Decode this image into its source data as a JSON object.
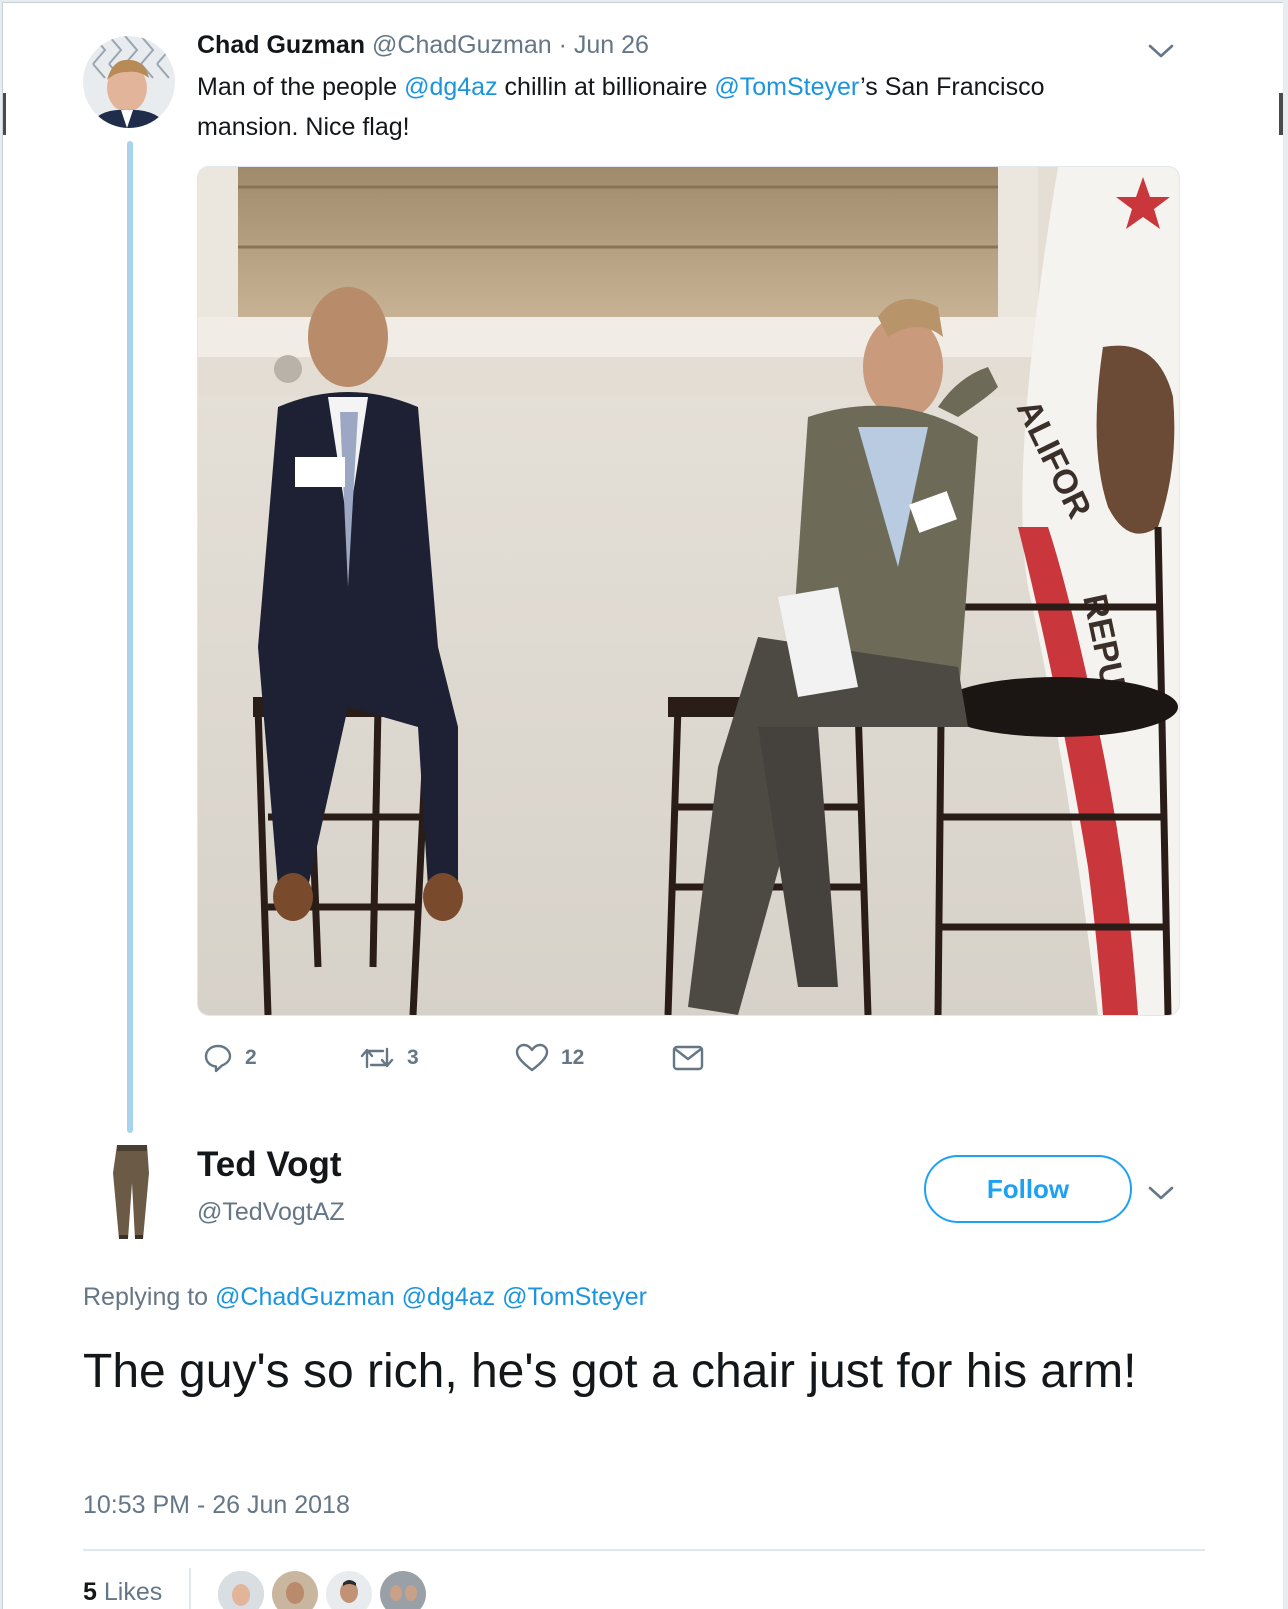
{
  "tweet": {
    "author_name": "Chad Guzman",
    "author_handle": "@ChadGuzman",
    "date": "· Jun 26",
    "text_1": "Man of the people ",
    "mention_1": "@dg4az",
    "text_2": " chillin at billionaire ",
    "mention_2": "@TomSteyer",
    "text_3": "’s San Francisco",
    "text_4": "mansion. Nice flag!",
    "photo_flag_text_1": "ALIFOR",
    "photo_flag_text_2": "REPU",
    "replies": "2",
    "retweets": "3",
    "likes": "12"
  },
  "reply": {
    "author_name": "Ted Vogt",
    "author_handle": "@TedVogtAZ",
    "follow_label": "Follow",
    "replying_prefix": "Replying to ",
    "replying_to": [
      "@ChadGuzman",
      "@dg4az",
      "@TomSteyer"
    ],
    "text": "The guy's so rich, he's got a chair just for his arm!",
    "timestamp": "10:53 PM - 26 Jun 2018",
    "likes_count": "5",
    "likes_label": "Likes"
  },
  "colors": {
    "link": "#1b95e0",
    "thread_line": "#a8d3ec",
    "muted": "#657786",
    "follow_border": "#1da1f2"
  },
  "icons": [
    "reply-icon",
    "retweet-icon",
    "like-icon",
    "dm-icon",
    "chevron-down-icon"
  ]
}
